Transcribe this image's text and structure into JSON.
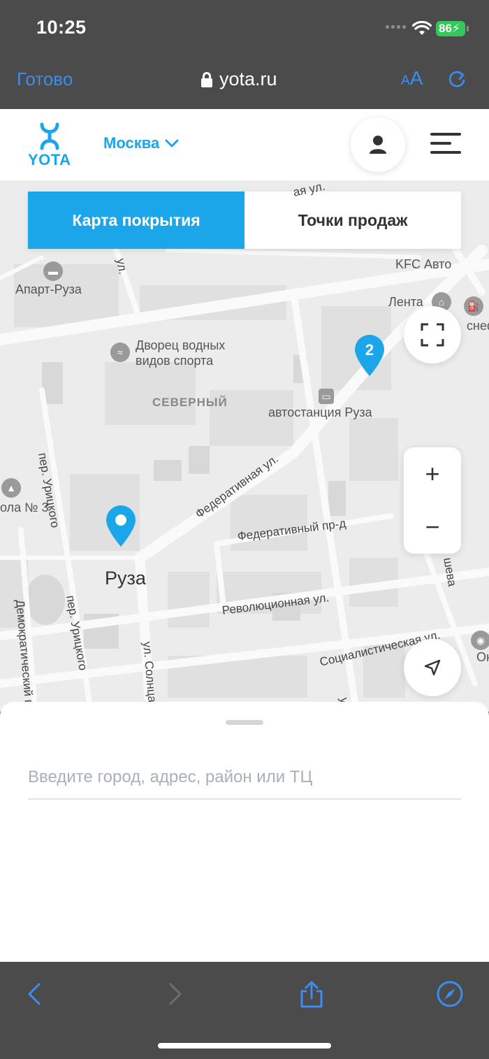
{
  "status_bar": {
    "time": "10:25",
    "battery": "86"
  },
  "browser": {
    "done_label": "Готово",
    "url": "yota.ru",
    "text_size_small": "A",
    "text_size_large": "A"
  },
  "header": {
    "logo_text": "YOTA",
    "city": "Москва"
  },
  "tabs": [
    {
      "label": "Карта покрытия",
      "active": true
    },
    {
      "label": "Точки продаж",
      "active": false
    }
  ],
  "map": {
    "labels": {
      "apart_ruza": "Апарт-Руза",
      "kfc": "KFC Авто",
      "lenta": "Лента",
      "rosneft": "снеф",
      "palace": "Дворец водных",
      "palace2": "видов спорта",
      "district": "СЕВЕРНЫЙ",
      "bus_station": "автостанция Руза",
      "school": "ола № 3",
      "city": "Руза",
      "cinema": "Октяб"
    },
    "streets": {
      "federativnaya": "Федеративная ул.",
      "federativny_pr": "Федеративный пр-д",
      "revolyutsionnaya": "Революционная ул.",
      "sotsialisticheskaya": "Социалистическая ул.",
      "uritskogo_top": "пер. Урицкого",
      "uritskogo": "пер. Урицкого",
      "demokraticheskiy": "Демократический п",
      "solntsa": "ул. Солнцa",
      "shevа": "шева",
      "top_ul": "ая ул.",
      "left_ul": "ул.",
      "bottom_ul": "ул"
    },
    "cluster_count": "2",
    "zoom_in": "+",
    "zoom_out": "−"
  },
  "search": {
    "placeholder": "Введите город, адрес, район или ТЦ",
    "value": ""
  },
  "colors": {
    "brand": "#1aa6e8",
    "ios_blue": "#3b8ef0",
    "battery_green": "#34c759"
  }
}
